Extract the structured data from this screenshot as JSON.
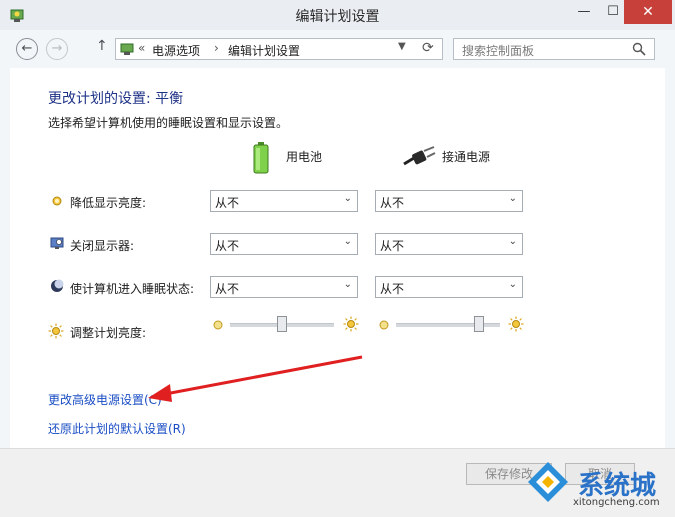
{
  "window": {
    "title": "编辑计划设置",
    "controls": {
      "minimize": "—",
      "maximize": "☐",
      "close": "✕"
    }
  },
  "nav": {
    "back": "←",
    "forward": "→",
    "up": "↑",
    "breadcrumb": [
      "电源选项",
      "编辑计划设置"
    ],
    "breadcrumb_prefix": "«",
    "separator": "›",
    "search_placeholder": "搜索控制面板"
  },
  "main": {
    "heading": "更改计划的设置: 平衡",
    "subtitle": "选择希望计算机使用的睡眠设置和显示设置。",
    "columns": [
      {
        "label": "用电池",
        "icon": "battery-icon"
      },
      {
        "label": "接通电源",
        "icon": "power-plug-icon"
      }
    ],
    "rows": [
      {
        "label": "降低显示亮度:",
        "icon": "dim-display-icon",
        "battery": "从不",
        "plugged": "从不"
      },
      {
        "label": "关闭显示器:",
        "icon": "display-off-icon",
        "battery": "从不",
        "plugged": "从不"
      },
      {
        "label": "使计算机进入睡眠状态:",
        "icon": "sleep-icon",
        "battery": "从不",
        "plugged": "从不"
      }
    ],
    "brightness": {
      "label": "调整计划亮度:",
      "battery_level": 0.5,
      "plugged_level": 0.8
    },
    "links": {
      "advanced": "更改高级电源设置(C)",
      "restore": "还原此计划的默认设置(R)"
    }
  },
  "footer": {
    "save": "保存修改",
    "cancel": "取消"
  },
  "watermark": {
    "brand": "系统城",
    "url": "xitongcheng.com"
  },
  "colors": {
    "heading": "#1e3287",
    "link": "#1a4ec4",
    "close": "#c7413a",
    "arrow": "#e02020"
  }
}
